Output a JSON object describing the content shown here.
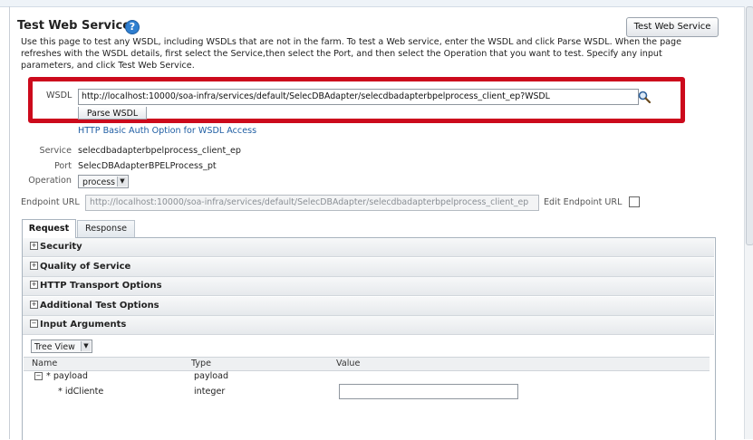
{
  "page": {
    "title": "Test Web Service",
    "help_icon": "?",
    "test_button_label": "Test Web Service",
    "description": "Use this page to test any WSDL, including WSDLs that are not in the farm. To test a Web service, enter the WSDL and click Parse WSDL. When the page refreshes with the WSDL details, first select the Service,then select the Port, and then select the Operation that you want to test. Specify any input parameters, and click Test Web Service."
  },
  "wsdl": {
    "label": "WSDL",
    "value": "http://localhost:10000/soa-infra/services/default/SelecDBAdapter/selecdbadapterbpelprocess_client_ep?WSDL",
    "search_icon": "magnifier-icon",
    "parse_button_label": "Parse WSDL",
    "auth_link": "HTTP Basic Auth Option for WSDL Access",
    "highlight_color": "#cc0a1c"
  },
  "details": {
    "service_label": "Service",
    "service_value": "selecdbadapterbpelprocess_client_ep",
    "port_label": "Port",
    "port_value": "SelecDBAdapterBPELProcess_pt",
    "operation_label": "Operation",
    "operation_value": "process",
    "endpoint_label": "Endpoint URL",
    "endpoint_value": "http://localhost:10000/soa-infra/services/default/SelecDBAdapter/selecdbadapterbpelprocess_client_ep",
    "edit_endpoint_label": "Edit Endpoint URL"
  },
  "tabs": [
    {
      "label": "Request"
    },
    {
      "label": "Response"
    }
  ],
  "sections": [
    {
      "label": "Security",
      "toggle": "+"
    },
    {
      "label": "Quality of Service",
      "toggle": "+"
    },
    {
      "label": "HTTP Transport Options",
      "toggle": "+"
    },
    {
      "label": "Additional Test Options",
      "toggle": "+"
    },
    {
      "label": "Input Arguments",
      "toggle": "−"
    }
  ],
  "input_args": {
    "view_select": "Tree View",
    "columns": [
      "Name",
      "Type",
      "Value"
    ],
    "rows": [
      {
        "toggle": "−",
        "name": "* payload",
        "type": "payload"
      },
      {
        "name": "* idCliente",
        "type": "integer",
        "value": ""
      }
    ]
  }
}
